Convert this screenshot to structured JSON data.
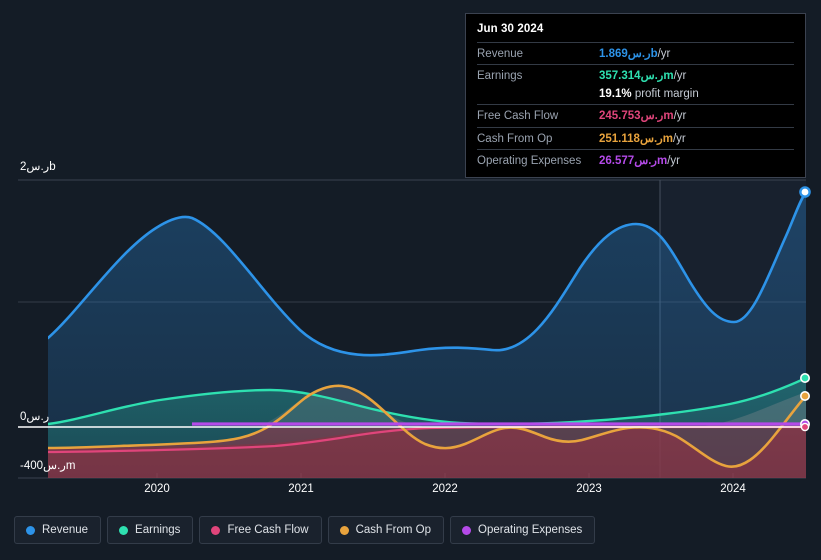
{
  "tooltip": {
    "date": "Jun 30 2024",
    "rows": [
      {
        "name": "Revenue",
        "value": "1.869ر.سb",
        "unit": "/yr",
        "color": "#2d93e8"
      },
      {
        "name": "Earnings",
        "value": "357.314ر.سm",
        "unit": "/yr",
        "color": "#2ee0b0"
      },
      {
        "name": "Free Cash Flow",
        "value": "245.753ر.سm",
        "unit": "/yr",
        "color": "#e0457b"
      },
      {
        "name": "Cash From Op",
        "value": "251.118ر.سm",
        "unit": "/yr",
        "color": "#e8a33d"
      },
      {
        "name": "Operating Expenses",
        "value": "26.577ر.سm",
        "unit": "/yr",
        "color": "#b44ae8"
      }
    ],
    "profit_margin_value": "19.1%",
    "profit_margin_label": "profit margin"
  },
  "legend": {
    "items": [
      {
        "label": "Revenue",
        "color": "#2d93e8"
      },
      {
        "label": "Earnings",
        "color": "#2ee0b0"
      },
      {
        "label": "Free Cash Flow",
        "color": "#e0457b"
      },
      {
        "label": "Cash From Op",
        "color": "#e8a33d"
      },
      {
        "label": "Operating Expenses",
        "color": "#b44ae8"
      }
    ]
  },
  "axes": {
    "y_top_label": "2ر.سb",
    "y_zero_label": "0ر.س",
    "y_bottom_label": "-400ر.سm",
    "x_labels": [
      "2020",
      "2021",
      "2022",
      "2023",
      "2024"
    ]
  },
  "chart_data": {
    "type": "area",
    "title": "",
    "xlabel": "",
    "ylabel": "",
    "grid": true,
    "legend_position": "bottom",
    "ylim": [
      -400000000,
      2000000000
    ],
    "y_ticks": [
      {
        "value": 2000000000,
        "label": "2ر.سb"
      },
      {
        "value": 1000000000,
        "label": ""
      },
      {
        "value": 0,
        "label": "0ر.س"
      },
      {
        "value": -400000000,
        "label": "-400ر.سm"
      }
    ],
    "x_ticks": [
      "2020",
      "2021",
      "2022",
      "2023",
      "2024"
    ],
    "x_range": [
      "2019-06",
      "2024-09"
    ],
    "forecast_divider_x": "2023-06",
    "currency": "ر.س",
    "series": [
      {
        "name": "Revenue",
        "color": "#2d93e8",
        "x": [
          "2019-06",
          "2019-12",
          "2020-06",
          "2020-12",
          "2021-06",
          "2021-12",
          "2022-06",
          "2022-12",
          "2023-03",
          "2023-06",
          "2023-12",
          "2024-06"
        ],
        "values": [
          760000000,
          1180000000,
          1570000000,
          1480000000,
          1200000000,
          920000000,
          790000000,
          810000000,
          1180000000,
          1080000000,
          960000000,
          1869000000
        ]
      },
      {
        "name": "Earnings",
        "color": "#2ee0b0",
        "x": [
          "2019-06",
          "2019-12",
          "2020-06",
          "2020-12",
          "2021-06",
          "2021-12",
          "2022-06",
          "2022-12",
          "2023-06",
          "2023-12",
          "2024-06"
        ],
        "values": [
          20000000,
          120000000,
          180000000,
          185000000,
          140000000,
          90000000,
          35000000,
          30000000,
          120000000,
          150000000,
          357314000
        ]
      },
      {
        "name": "Free Cash Flow",
        "color": "#e0457b",
        "x": [
          "2019-06",
          "2019-12",
          "2020-06",
          "2020-12",
          "2021-06",
          "2021-12",
          "2022-06",
          "2022-12",
          "2023-06",
          "2023-12",
          "2024-06"
        ],
        "values": [
          -300000000,
          -290000000,
          -280000000,
          -230000000,
          -30000000,
          20000000,
          -20000000,
          -10000000,
          10000000,
          -150000000,
          245753000
        ]
      },
      {
        "name": "Cash From Op",
        "color": "#e8a33d",
        "x": [
          "2019-06",
          "2019-12",
          "2020-06",
          "2020-12",
          "2021-06",
          "2021-12",
          "2022-06",
          "2022-12",
          "2023-06",
          "2023-12",
          "2024-06"
        ],
        "values": [
          -290000000,
          -285000000,
          -275000000,
          -215000000,
          240000000,
          115000000,
          -95000000,
          -45000000,
          -30000000,
          -335000000,
          251118000
        ]
      },
      {
        "name": "Operating Expenses",
        "color": "#b44ae8",
        "x": [
          "2020-09",
          "2021-06",
          "2022-06",
          "2023-06",
          "2024-06"
        ],
        "values": [
          26000000,
          26000000,
          26000000,
          26000000,
          26577000
        ]
      }
    ],
    "highlight_point": {
      "date": "Jun 30 2024",
      "revenue": 1869000000,
      "earnings": 357314000,
      "free_cash_flow": 245753000,
      "cash_from_op": 251118000,
      "operating_expenses": 26577000,
      "profit_margin": "19.1%"
    }
  }
}
